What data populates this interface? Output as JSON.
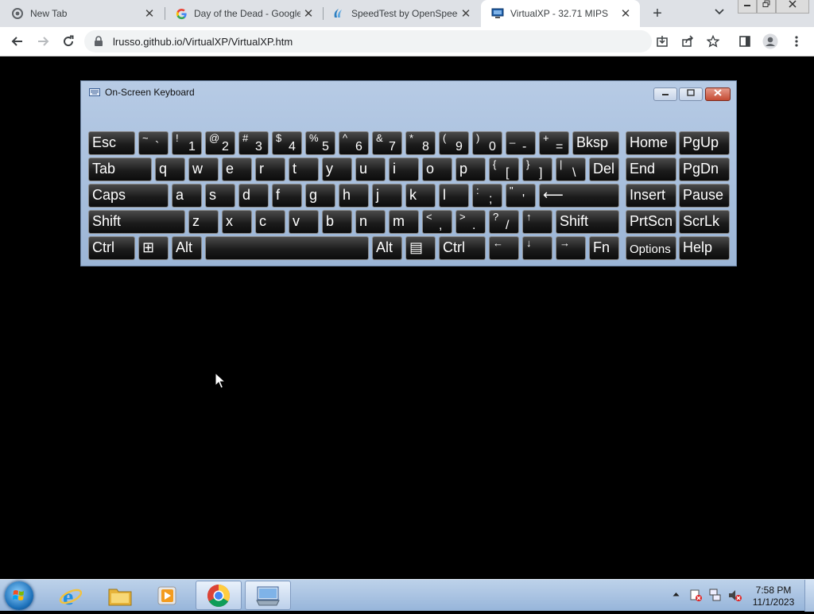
{
  "browser": {
    "tabs": [
      {
        "title": "New Tab",
        "close": "✕"
      },
      {
        "title": "Day of the Dead - Google",
        "close": "✕"
      },
      {
        "title": "SpeedTest by OpenSpeed",
        "close": "✕"
      },
      {
        "title": "VirtualXP - 32.71 MIPS",
        "close": "✕"
      }
    ],
    "new_tab": "+",
    "url": "lrusso.github.io/VirtualXP/VirtualXP.htm"
  },
  "osk": {
    "title": "On-Screen Keyboard",
    "rows": [
      [
        {
          "label": "Esc"
        },
        {
          "sm": "~",
          "lg": "`"
        },
        {
          "sm": "!",
          "lg": "1"
        },
        {
          "sm": "@",
          "lg": "2"
        },
        {
          "sm": "#",
          "lg": "3"
        },
        {
          "sm": "$",
          "lg": "4"
        },
        {
          "sm": "%",
          "lg": "5"
        },
        {
          "sm": "^",
          "lg": "6"
        },
        {
          "sm": "&",
          "lg": "7"
        },
        {
          "sm": "*",
          "lg": "8"
        },
        {
          "sm": "(",
          "lg": "9"
        },
        {
          "sm": ")",
          "lg": "0"
        },
        {
          "sm": "_",
          "lg": "-"
        },
        {
          "sm": "+",
          "lg": "="
        },
        {
          "label": "Bksp"
        },
        {
          "label": "Home"
        },
        {
          "label": "PgUp"
        }
      ],
      [
        {
          "label": "Tab"
        },
        {
          "label": "q"
        },
        {
          "label": "w"
        },
        {
          "label": "e"
        },
        {
          "label": "r"
        },
        {
          "label": "t"
        },
        {
          "label": "y"
        },
        {
          "label": "u"
        },
        {
          "label": "i"
        },
        {
          "label": "o"
        },
        {
          "label": "p"
        },
        {
          "sm": "{",
          "lg": "["
        },
        {
          "sm": "}",
          "lg": "]"
        },
        {
          "sm": "|",
          "lg": "\\"
        },
        {
          "label": "Del"
        },
        {
          "label": "End"
        },
        {
          "label": "PgDn"
        }
      ],
      [
        {
          "label": "Caps"
        },
        {
          "label": "a"
        },
        {
          "label": "s"
        },
        {
          "label": "d"
        },
        {
          "label": "f"
        },
        {
          "label": "g"
        },
        {
          "label": "h"
        },
        {
          "label": "j"
        },
        {
          "label": "k"
        },
        {
          "label": "l"
        },
        {
          "sm": ":",
          "lg": ";"
        },
        {
          "sm": "\"",
          "lg": "'"
        },
        {
          "label": "⟵"
        },
        {
          "label": "Insert"
        },
        {
          "label": "Pause"
        }
      ],
      [
        {
          "label": "Shift"
        },
        {
          "label": "z"
        },
        {
          "label": "x"
        },
        {
          "label": "c"
        },
        {
          "label": "v"
        },
        {
          "label": "b"
        },
        {
          "label": "n"
        },
        {
          "label": "m"
        },
        {
          "sm": "<",
          "lg": ","
        },
        {
          "sm": ">",
          "lg": "."
        },
        {
          "sm": "?",
          "lg": "/"
        },
        {
          "sm": "↑"
        },
        {
          "label": "Shift"
        },
        {
          "label": "PrtScn"
        },
        {
          "label": "ScrLk"
        }
      ],
      [
        {
          "label": "Ctrl"
        },
        {
          "label": "⊞"
        },
        {
          "label": "Alt"
        },
        {
          "label": ""
        },
        {
          "label": "Alt"
        },
        {
          "label": "▤"
        },
        {
          "label": "Ctrl"
        },
        {
          "sm": "←"
        },
        {
          "sm": "↓"
        },
        {
          "sm": "→"
        },
        {
          "label": "Fn"
        },
        {
          "label": "Options"
        },
        {
          "label": "Help"
        }
      ]
    ]
  },
  "taskbar": {
    "apps": [
      "internet-explorer",
      "windows-explorer",
      "media-player",
      "google-chrome",
      "on-screen-keyboard"
    ],
    "time": "7:58 PM",
    "date": "11/1/2023"
  }
}
